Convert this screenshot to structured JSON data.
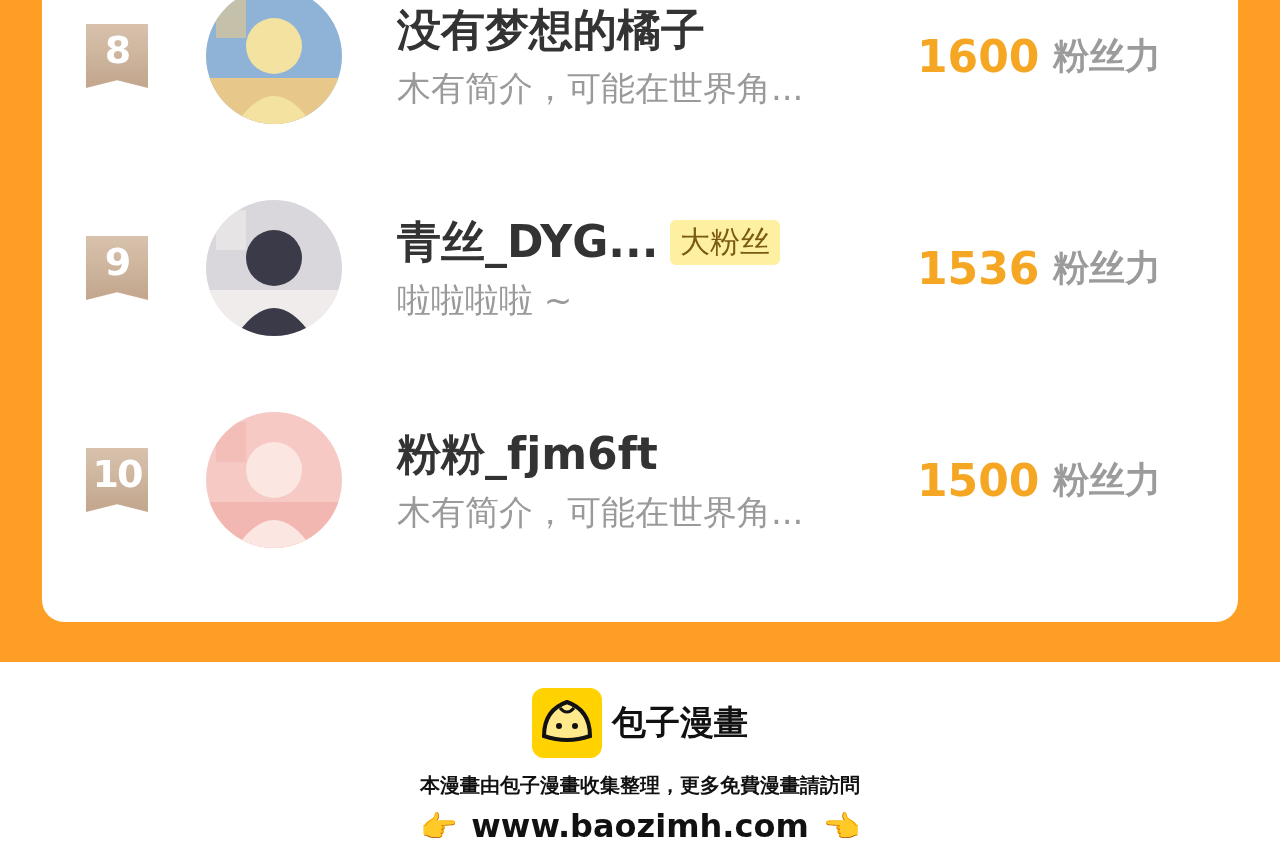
{
  "ranking": [
    {
      "rank": "8",
      "name": "没有梦想的橘子",
      "bio": "木有简介，可能在世界角...",
      "score": "1600",
      "score_unit": "粉丝力"
    },
    {
      "rank": "9",
      "name": "青丝_DYG...",
      "badge": "大粉丝",
      "bio": "啦啦啦啦 ~",
      "score": "1536",
      "score_unit": "粉丝力"
    },
    {
      "rank": "10",
      "name": "粉粉_fjm6ft",
      "bio": "木有简介，可能在世界角...",
      "score": "1500",
      "score_unit": "粉丝力"
    }
  ],
  "footer": {
    "brand": "包子漫畫",
    "notice": "本漫畫由包子漫畫收集整理，更多免費漫畫請訪問",
    "left_pointer": "👉",
    "url": "www.baozimh.com",
    "right_pointer": "👈"
  }
}
